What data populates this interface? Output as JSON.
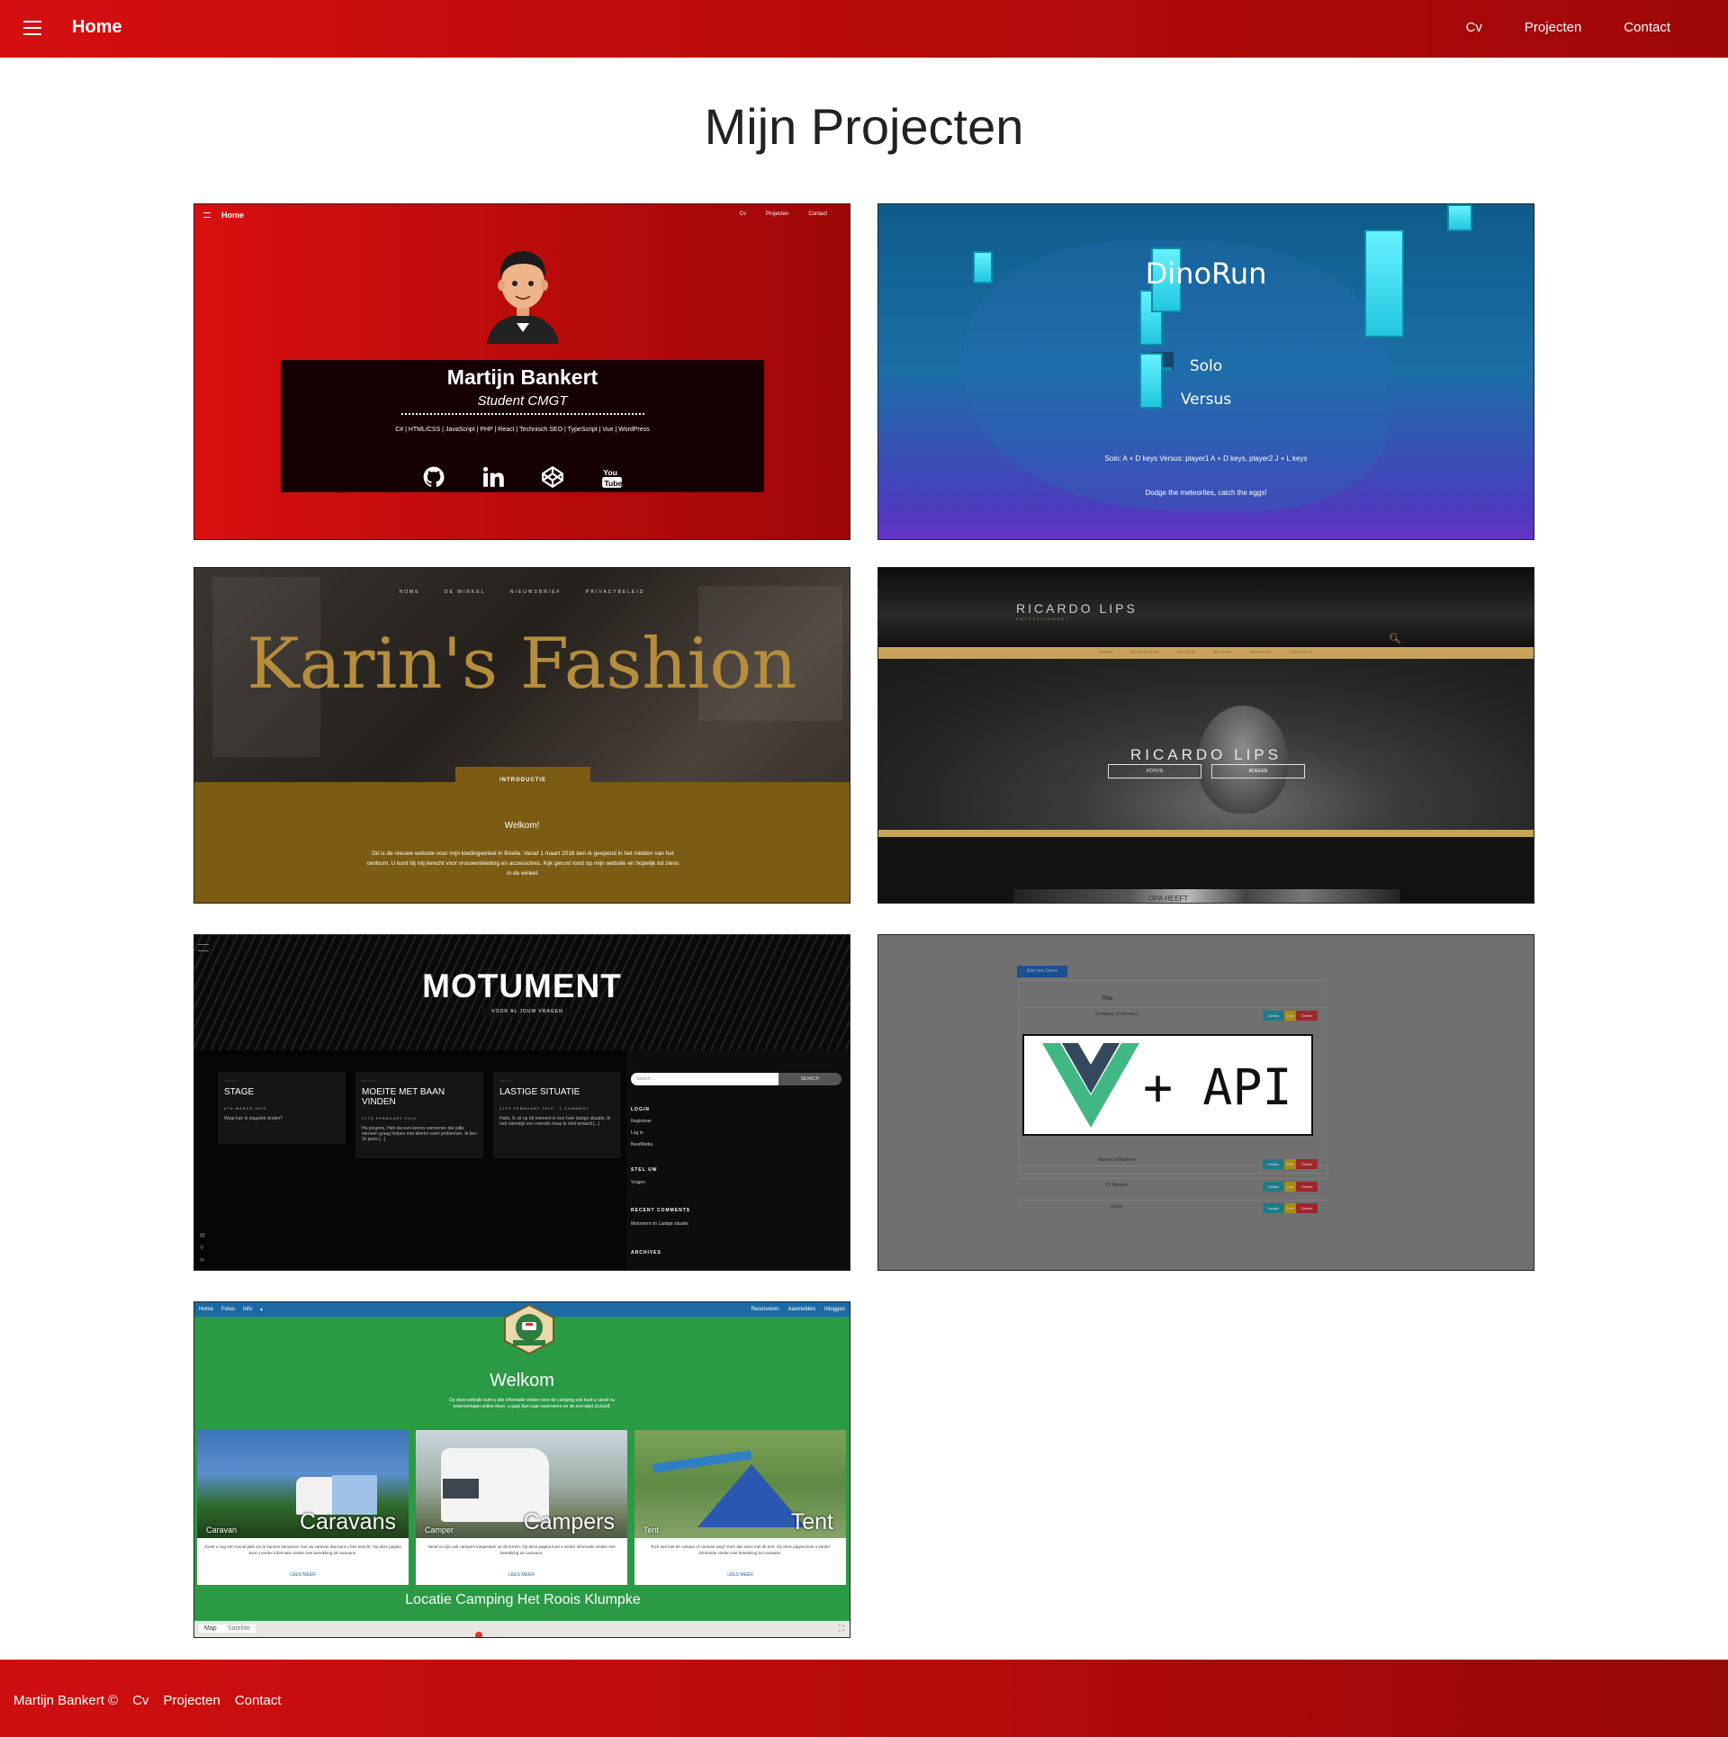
{
  "nav": {
    "brand": "Home",
    "links": [
      "Cv",
      "Projecten",
      "Contact"
    ]
  },
  "page": {
    "title": "Mijn Projecten"
  },
  "projects": {
    "portfolio": {
      "nav_brand": "Home",
      "nav_links": [
        "Cv",
        "Projecten",
        "Contact"
      ],
      "name": "Martijn Bankert",
      "role": "Student CMGT",
      "skills": "C# | HTML/CSS | JavaScript | PHP | React | Technisch SEO | TypeScript | Vue | WordPress",
      "icons": [
        "github-icon",
        "linkedin-icon",
        "codepen-icon",
        "youtube-icon"
      ]
    },
    "dinorun": {
      "title": "DinoRun",
      "solo": "Solo",
      "versus": "Versus",
      "keys": "Solo: A + D keys Versus: player1 A + D keys, player2 J + L keys",
      "tagline": "Dodge the meteorites, catch the eggs!"
    },
    "fashion": {
      "menu": [
        "HOME",
        "DE WINKEL",
        "NIEUWSBRIEF",
        "PRIVACYBELEID"
      ],
      "title": "Karin's Fashion",
      "intro_tab": "INTRODUCTIE",
      "welcome": "Welkom!",
      "text": "Dit is de nieuwe website voor mijn kledingwinkel in Brielle. Vanaf 1 maart 2018 ben ik geopend in het midden van het centrum. U kunt bij mij terecht voor vrouwenkleding en accessoires. Kijk gerust rond op mijn website en hopelijk tot ziens in de winkel."
    },
    "ricardo": {
      "logo": "RICARDO LIPS",
      "logo_sub": "ENTERTAINMENT",
      "menu": [
        "HOME",
        "BIOGRAFIE",
        "FOTO'S",
        "MUZIEK",
        "BOEKEN",
        "CONTACT"
      ],
      "name": "RICARDO LIPS",
      "buttons": [
        "FOTO'S",
        "BOEKEN"
      ],
      "thumb_text": "OPA HEEFT"
    },
    "motument": {
      "title": "MOTUMENT",
      "subtitle": "VOOR AL JOUW VRAGEN",
      "posts": [
        {
          "category": "VRAAG",
          "title": "STAGE",
          "meta": "6TH MARCH 2019",
          "excerpt": "Waar kan ik stagelek vinden?"
        },
        {
          "category": "VRAAG",
          "title": "MOEITE MET BAAN VINDEN",
          "meta": "27TH FEBRUARY 2019",
          "excerpt": "Ha jongens, Heb via een kennis vernomen dat jullie mensen graag helpen met allerlei soort problemen. Ik ben 2e jaars [...]"
        },
        {
          "category": "VRAAG",
          "title": "LASTIGE SITUATIE",
          "meta": "21ST FEBRUARY 2019 · 1 COMMENT",
          "excerpt": "Hallo, Ik zit op dit moment in een hele lastige situatie. Ik heb namelijk een vriendin maar ik vind iemand [...]"
        }
      ],
      "search_placeholder": "Search ...",
      "search_button": "SEARCH",
      "widgets": {
        "login_title": "LOGIN",
        "login_links": [
          "Registreer",
          "Log in",
          "BearMedia"
        ],
        "ask_title": "STEL UW",
        "ask_links": [
          "Vragen"
        ],
        "comments_title": "RECENT COMMENTS",
        "comments": [
          "Motument on Lastige situatie"
        ],
        "archives_title": "ARCHIVES"
      }
    },
    "vueapi": {
      "add_button": "Add new Game",
      "column": "Title",
      "rows": [
        "Company of Heroes 2",
        "Agents of Mayhem",
        "21 Bossen",
        "Doom"
      ],
      "actions": [
        "Details",
        "Edit",
        "Delete"
      ],
      "label": "+ API"
    },
    "camping": {
      "nav_left": [
        "Home",
        "Fotos",
        "Info"
      ],
      "nav_right": [
        "Reserveren",
        "Aanmelden",
        "Inloggen"
      ],
      "welcome": "Welkom",
      "welcome_text": "Op deze website kunt u alle informatie vinden over de camping ook kunt u vanaf nu reserveringen online doen. u gaat dan naar reserveren en de rest wijst zichzelf.",
      "tiles": [
        {
          "big": "Caravans",
          "small": "Caravan",
          "desc": "Zoekt u nog een mooie plek om te kunnen kamperen met uw caravan dan kunt u hier terecht. Op deze pagina kunt u verder informatie vinden met betrekking tot caravans.",
          "more": "LEES MEER"
        },
        {
          "big": "Campers",
          "small": "Camper",
          "desc": "Vanaf nu zijn ook campers toegestaan op dit terrein. Op deze pagina kunt u verder informatie vinden met betrekking tot caravans.",
          "more": "LEES MEER"
        },
        {
          "big": "Tent",
          "small": "Tent",
          "desc": "Toch niet met de camper of caravan weg? Kom dan eens met de tent. Op deze pagina kunt u verder informatie vinden met betrekking tot caravans.",
          "more": "LEES MEER"
        }
      ],
      "location": "Locatie Camping Het Roois Klumpke",
      "map_buttons": [
        "Map",
        "Satellite"
      ]
    }
  },
  "footer": {
    "copyright": "Martijn Bankert ©",
    "links": [
      "Cv",
      "Projecten",
      "Contact"
    ]
  },
  "colors": {
    "brand_red": "#c40d0d",
    "fashion_gold": "#7c5b13",
    "ricardo_gold": "#c7a35a",
    "camping_green": "#2b9a45",
    "camping_blue": "#1b6aa5"
  }
}
